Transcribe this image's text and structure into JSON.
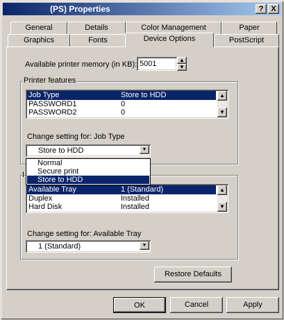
{
  "window": {
    "title": "(PS) Properties",
    "help_glyph": "?",
    "close_glyph": "X"
  },
  "tabs_back": [
    "General",
    "Details",
    "Color Management",
    "Paper"
  ],
  "tabs_front": [
    "Graphics",
    "Fonts",
    "Device Options",
    "PostScript"
  ],
  "active_tab": "Device Options",
  "memory": {
    "label": "Available printer memory (in KB):",
    "value": "5001"
  },
  "features": {
    "group_label": "Printer features",
    "list": [
      {
        "name": "Job Type",
        "value": "Store to HDD",
        "selected": true
      },
      {
        "name": "PASSWORD1",
        "value": "0",
        "selected": false
      },
      {
        "name": "PASSWORD2",
        "value": "0",
        "selected": false
      }
    ],
    "change_label": "Change setting for:  Job Type",
    "combo_value": "Store to HDD",
    "dropdown_options": [
      {
        "label": "Normal",
        "selected": false
      },
      {
        "label": "Secure print",
        "selected": false
      },
      {
        "label": "Store to HDD",
        "selected": true
      }
    ]
  },
  "installable": {
    "list": [
      {
        "name": "Available Tray",
        "value": "1 (Standard)",
        "selected": true
      },
      {
        "name": "Duplex",
        "value": "Installed",
        "selected": false
      },
      {
        "name": "Hard Disk",
        "value": "Installed",
        "selected": false
      }
    ],
    "change_label": "Change setting for:  Available Tray",
    "combo_value": "1 (Standard)"
  },
  "buttons": {
    "restore": "Restore Defaults",
    "ok": "OK",
    "cancel": "Cancel",
    "apply": "Apply"
  },
  "colors": {
    "face": "#d4d0c8",
    "selection": "#0a246a",
    "title_start": "#0a246a",
    "title_end": "#a6caf0"
  }
}
